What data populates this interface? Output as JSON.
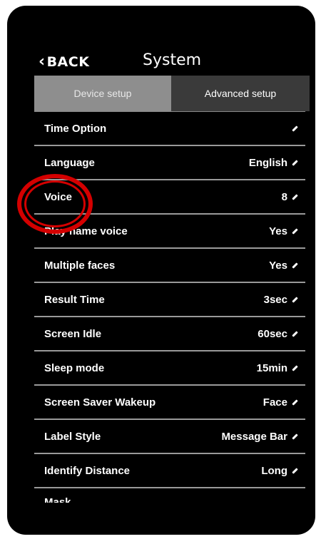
{
  "header": {
    "back_label": "BACK",
    "back_icon": "chevron-left-icon",
    "title": "System"
  },
  "tabs": [
    {
      "label": "Device setup",
      "active": true
    },
    {
      "label": "Advanced setup",
      "active": false
    }
  ],
  "settings": [
    {
      "label": "Time Option",
      "value": ""
    },
    {
      "label": "Language",
      "value": "English"
    },
    {
      "label": "Voice",
      "value": "8"
    },
    {
      "label": "Play name voice",
      "value": "Yes"
    },
    {
      "label": "Multiple faces",
      "value": "Yes"
    },
    {
      "label": "Result Time",
      "value": "3sec"
    },
    {
      "label": "Screen Idle",
      "value": "60sec"
    },
    {
      "label": "Sleep mode",
      "value": "15min"
    },
    {
      "label": "Screen Saver Wakeup",
      "value": "Face"
    },
    {
      "label": "Label Style",
      "value": "Message Bar"
    },
    {
      "label": "Identify Distance",
      "value": "Long"
    }
  ],
  "partial_row": {
    "label": "Mask"
  },
  "colors": {
    "background": "#000000",
    "tab_active": "#8e8e8e",
    "tab_inactive": "#3a3a3a",
    "highlight": "#d40000"
  }
}
